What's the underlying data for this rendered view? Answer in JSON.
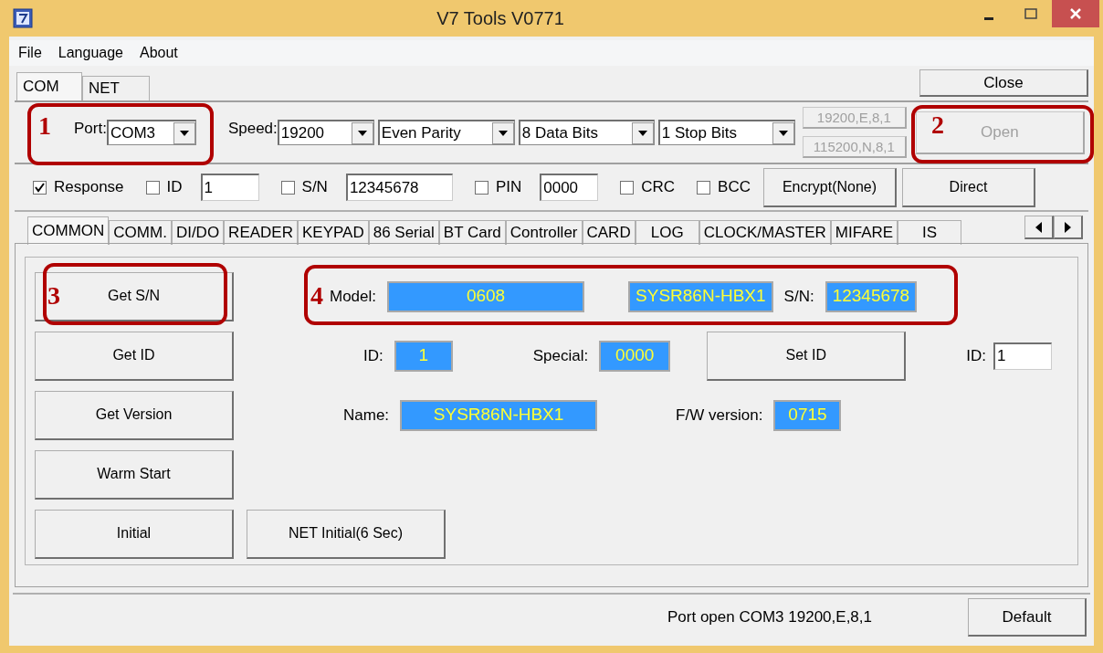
{
  "window": {
    "title": "V7 Tools V0771"
  },
  "menu": [
    "File",
    "Language",
    "About"
  ],
  "conn_tabs": [
    {
      "label": "COM",
      "selected": true
    },
    {
      "label": "NET",
      "selected": false
    }
  ],
  "close_button": "Close",
  "port": {
    "label": "Port:",
    "value": "COM3"
  },
  "speed": {
    "label": "Speed:",
    "selects": [
      {
        "value": "19200"
      },
      {
        "value": "Even Parity"
      },
      {
        "value": "8 Data Bits"
      },
      {
        "value": "1 Stop Bits"
      }
    ]
  },
  "presets": [
    {
      "label": "19200,E,8,1",
      "disabled": true
    },
    {
      "label": "115200,N,8,1",
      "disabled": true
    }
  ],
  "open_button": {
    "label": "Open",
    "disabled": true
  },
  "options": [
    {
      "kind": "check",
      "label": "Response",
      "checked": true
    },
    {
      "kind": "check",
      "label": "ID",
      "checked": false
    },
    {
      "kind": "input",
      "value": "1"
    },
    {
      "kind": "check",
      "label": "S/N",
      "checked": false
    },
    {
      "kind": "input",
      "value": "12345678"
    },
    {
      "kind": "check",
      "label": "PIN",
      "checked": false
    },
    {
      "kind": "input",
      "value": "0000"
    },
    {
      "kind": "check",
      "label": "CRC",
      "checked": false
    },
    {
      "kind": "check",
      "label": "BCC",
      "checked": false
    }
  ],
  "encrypt_button": "Encrypt(None)",
  "direct_button": "Direct",
  "func_tabs": [
    {
      "label": "COMMON",
      "selected": true
    },
    {
      "label": "COMM.",
      "selected": false
    },
    {
      "label": "DI/DO",
      "selected": false
    },
    {
      "label": "READER",
      "selected": false
    },
    {
      "label": "KEYPAD",
      "selected": false
    },
    {
      "label": "86 Serial",
      "selected": false
    },
    {
      "label": "BT Card",
      "selected": false
    },
    {
      "label": "Controller",
      "selected": false
    },
    {
      "label": "CARD",
      "selected": false
    },
    {
      "label": "LOG",
      "selected": false
    },
    {
      "label": "CLOCK/MASTER",
      "selected": false
    },
    {
      "label": "MIFARE",
      "selected": false
    },
    {
      "label": "IS",
      "selected": false
    }
  ],
  "common": {
    "rows": [
      {
        "button": "Get S/N",
        "items": [
          {
            "kind": "label",
            "text": "Model:"
          },
          {
            "kind": "value",
            "text": "0608"
          },
          {
            "kind": "value",
            "text": "SYSR86N-HBX1"
          },
          {
            "kind": "label",
            "text": "S/N:"
          },
          {
            "kind": "value",
            "text": "12345678"
          }
        ]
      },
      {
        "button": "Get ID",
        "items": [
          {
            "kind": "label",
            "text": "ID:"
          },
          {
            "kind": "value",
            "text": "1"
          },
          {
            "kind": "label",
            "text": "Special:"
          },
          {
            "kind": "value",
            "text": "0000"
          },
          {
            "kind": "button",
            "text": "Set ID"
          },
          {
            "kind": "label",
            "text": "ID:"
          },
          {
            "kind": "input",
            "text": "1"
          }
        ]
      },
      {
        "button": "Get Version",
        "items": [
          {
            "kind": "label",
            "text": "Name:"
          },
          {
            "kind": "value",
            "text": "SYSR86N-HBX1"
          },
          {
            "kind": "label",
            "text": "F/W version:"
          },
          {
            "kind": "value",
            "text": "0715"
          }
        ]
      },
      {
        "button": "Warm Start",
        "items": []
      },
      {
        "button": "Initial",
        "items": [
          {
            "kind": "button",
            "text": "NET Initial(6 Sec)"
          }
        ]
      }
    ]
  },
  "status_bar": {
    "text": "Port open COM3 19200,E,8,1",
    "button": "Default"
  },
  "annotations": [
    {
      "label": "1"
    },
    {
      "label": "2"
    },
    {
      "label": "3"
    },
    {
      "label": "4"
    }
  ]
}
